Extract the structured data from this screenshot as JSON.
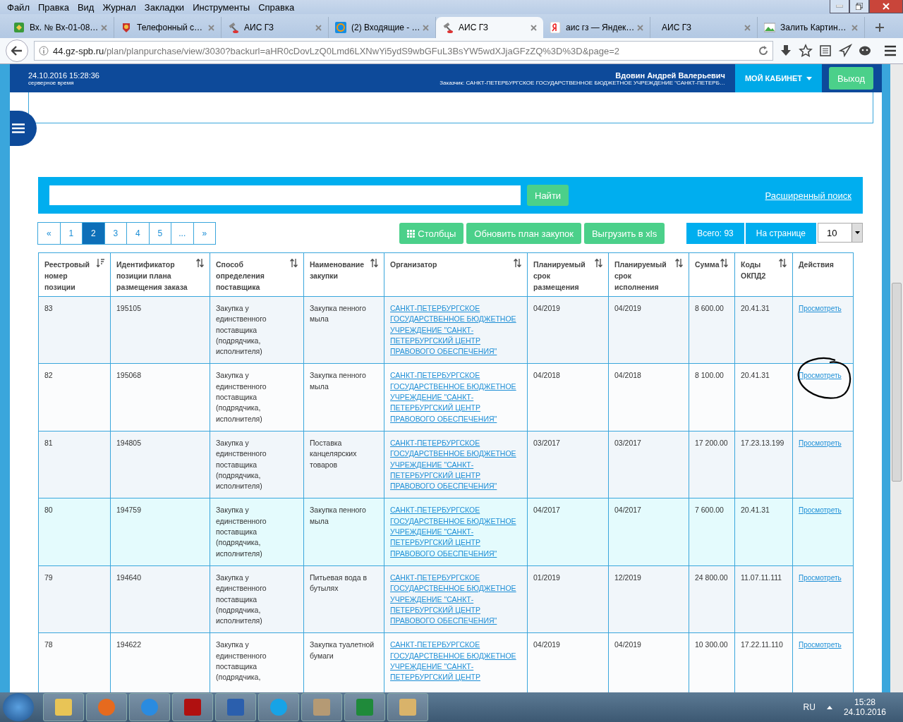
{
  "menu": [
    "Файл",
    "Правка",
    "Вид",
    "Журнал",
    "Закладки",
    "Инструменты",
    "Справка"
  ],
  "tabs": [
    {
      "title": "Вх. № Вх-01-08…",
      "kind": "doc",
      "selected": false
    },
    {
      "title": "Телефонный с…",
      "kind": "emblem",
      "selected": false
    },
    {
      "title": "АИС ГЗ",
      "kind": "gavel",
      "selected": false
    },
    {
      "title": "(2) Входящие - …",
      "kind": "mail",
      "selected": false
    },
    {
      "title": "АИС ГЗ",
      "kind": "gavel",
      "selected": true
    },
    {
      "title": "аис гз — Яндек…",
      "kind": "yandex",
      "selected": false
    },
    {
      "title": "АИС ГЗ",
      "kind": "plain",
      "selected": false
    },
    {
      "title": "Залить Картин…",
      "kind": "image",
      "selected": false
    }
  ],
  "address": {
    "host": "44.gz-spb.ru",
    "path": "/plan/planpurchase/view/3030?backurl=aHR0cDovLzQ0Lmd6LXNwYi5ydS9wbGFuL3BsYW5wdXJjaGFzZQ%3D%3D&page=2"
  },
  "header": {
    "datetime": "24.10.2016 15:28:36",
    "datetime_note": "серверное время",
    "user": "Вдовин Андрей Валерьевич",
    "customer": "Заказчик: САНКТ-ПЕТЕРБУРГСКОЕ ГОСУДАРСТВЕННОЕ БЮДЖЕТНОЕ УЧРЕЖДЕНИЕ \"САНКТ-ПЕТЕРБ…",
    "cabinet": "МОЙ КАБИНЕТ",
    "logout": "Выход"
  },
  "search": {
    "button": "Найти",
    "advanced": "Расширенный поиск"
  },
  "pagination": [
    {
      "label": "«",
      "selected": false
    },
    {
      "label": "1",
      "selected": false
    },
    {
      "label": "2",
      "selected": true
    },
    {
      "label": "3",
      "selected": false
    },
    {
      "label": "4",
      "selected": false
    },
    {
      "label": "5",
      "selected": false
    },
    {
      "label": "...",
      "selected": false
    },
    {
      "label": "»",
      "selected": false
    }
  ],
  "actions": {
    "columns": "Столбцы",
    "refresh": "Обновить план закупок",
    "export": "Выгрузить в xls",
    "total": "Всего: 93",
    "per_page_label": "На странице",
    "per_page": "10"
  },
  "table": {
    "columns": [
      {
        "label": "Реестровый номер позиции",
        "kind": "sorted"
      },
      {
        "label": "Идентификатор позиции плана размещения заказа",
        "kind": "sortable"
      },
      {
        "label": "Способ определения поставщика",
        "kind": "sortable"
      },
      {
        "label": "Наименование закупки",
        "kind": "sortable"
      },
      {
        "label": "Организатор",
        "kind": "sortable"
      },
      {
        "label": "Планируемый срок размещения",
        "kind": "sortable"
      },
      {
        "label": "Планируемый срок исполнения",
        "kind": "sortable"
      },
      {
        "label": "Сумма",
        "kind": "sortable"
      },
      {
        "label": "Коды ОКПД2",
        "kind": "sortable"
      },
      {
        "label": "Действия",
        "kind": "plain"
      }
    ],
    "rows": [
      {
        "cells": [
          "83",
          "195105",
          "Закупка у единственного поставщика (подрядчика, исполнителя)",
          "Закупка пенного мыла",
          "САНКТ-ПЕТЕРБУРГСКОЕ ГОСУДАРСТВЕННОЕ БЮДЖЕТНОЕ УЧРЕЖДЕНИЕ \"САНКТ-ПЕТЕРБУРГСКИЙ ЦЕНТР ПРАВОВОГО ОБЕСПЕЧЕНИЯ\"",
          "04/2019",
          "04/2019",
          "8 600.00",
          "20.41.31"
        ],
        "action": "Просмотреть",
        "hovered": false,
        "circled": false
      },
      {
        "cells": [
          "82",
          "195068",
          "Закупка у единственного поставщика (подрядчика, исполнителя)",
          "Закупка пенного мыла",
          "САНКТ-ПЕТЕРБУРГСКОЕ ГОСУДАРСТВЕННОЕ БЮДЖЕТНОЕ УЧРЕЖДЕНИЕ \"САНКТ-ПЕТЕРБУРГСКИЙ ЦЕНТР ПРАВОВОГО ОБЕСПЕЧЕНИЯ\"",
          "04/2018",
          "04/2018",
          "8 100.00",
          "20.41.31"
        ],
        "action": "Просмотреть",
        "hovered": false,
        "circled": true
      },
      {
        "cells": [
          "81",
          "194805",
          "Закупка у единственного поставщика (подрядчика, исполнителя)",
          "Поставка канцелярских товаров",
          "САНКТ-ПЕТЕРБУРГСКОЕ ГОСУДАРСТВЕННОЕ БЮДЖЕТНОЕ УЧРЕЖДЕНИЕ \"САНКТ-ПЕТЕРБУРГСКИЙ ЦЕНТР ПРАВОВОГО ОБЕСПЕЧЕНИЯ\"",
          "03/2017",
          "03/2017",
          "17 200.00",
          "17.23.13.199"
        ],
        "action": "Просмотреть",
        "hovered": false,
        "circled": false
      },
      {
        "cells": [
          "80",
          "194759",
          "Закупка у единственного поставщика (подрядчика, исполнителя)",
          "Закупка пенного мыла",
          "САНКТ-ПЕТЕРБУРГСКОЕ ГОСУДАРСТВЕННОЕ БЮДЖЕТНОЕ УЧРЕЖДЕНИЕ \"САНКТ-ПЕТЕРБУРГСКИЙ ЦЕНТР ПРАВОВОГО ОБЕСПЕЧЕНИЯ\"",
          "04/2017",
          "04/2017",
          "7 600.00",
          "20.41.31"
        ],
        "action": "Просмотреть",
        "hovered": true,
        "circled": false
      },
      {
        "cells": [
          "79",
          "194640",
          "Закупка у единственного поставщика (подрядчика, исполнителя)",
          "Питьевая вода в бутылях",
          "САНКТ-ПЕТЕРБУРГСКОЕ ГОСУДАРСТВЕННОЕ БЮДЖЕТНОЕ УЧРЕЖДЕНИЕ \"САНКТ-ПЕТЕРБУРГСКИЙ ЦЕНТР ПРАВОВОГО ОБЕСПЕЧЕНИЯ\"",
          "01/2019",
          "12/2019",
          "24 800.00",
          "11.07.11.111"
        ],
        "action": "Просмотреть",
        "hovered": false,
        "circled": false
      },
      {
        "cells": [
          "78",
          "194622",
          "Закупка у единственного поставщика (подрядчика,",
          "Закупка туалетной бумаги",
          "САНКТ-ПЕТЕРБУРГСКОЕ ГОСУДАРСТВЕННОЕ БЮДЖЕТНОЕ УЧРЕЖДЕНИЕ \"САНКТ-ПЕТЕРБУРГСКИЙ ЦЕНТР",
          "04/2019",
          "04/2019",
          "10 300.00",
          "17.22.11.110"
        ],
        "action": "Просмотреть",
        "hovered": false,
        "circled": false
      }
    ]
  },
  "taskbar": {
    "apps": [
      {
        "kind": "explorer"
      },
      {
        "kind": "firefox"
      },
      {
        "kind": "ie"
      },
      {
        "kind": "acrobat"
      },
      {
        "kind": "word"
      },
      {
        "kind": "skype"
      },
      {
        "kind": "app"
      },
      {
        "kind": "excel"
      },
      {
        "kind": "paint"
      }
    ],
    "lang": "RU",
    "time": "15:28",
    "date": "24.10.2016"
  }
}
